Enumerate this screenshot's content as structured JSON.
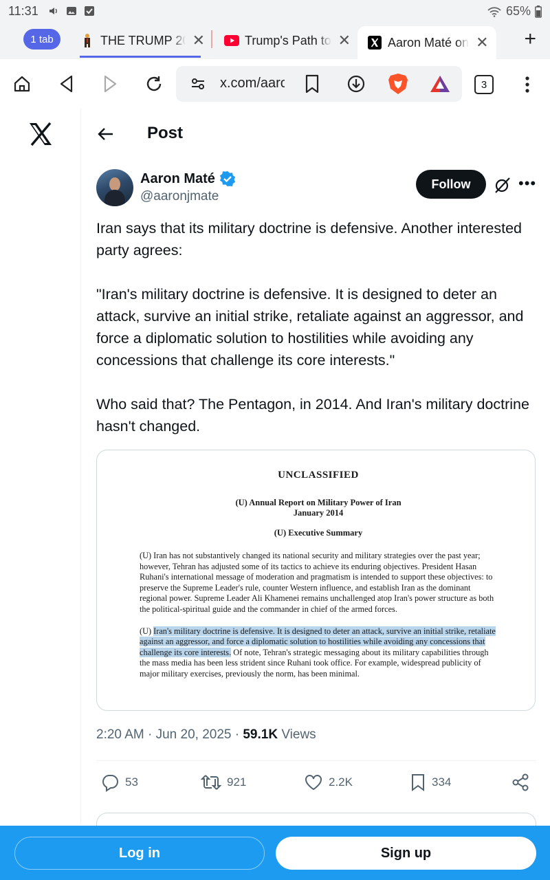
{
  "status_bar": {
    "time": "11:31",
    "battery": "65%"
  },
  "browser": {
    "tab_count_label": "1 tab",
    "tabs": [
      {
        "title": "THE TRUMP 20",
        "favicon": "trump-figure-icon"
      },
      {
        "title": "Trump's Path to",
        "favicon": "youtube-icon"
      },
      {
        "title": "Aaron Maté on",
        "favicon": "x-icon",
        "active": true
      }
    ],
    "url": "x.com/aaronjmate",
    "open_tabs": "3"
  },
  "page": {
    "header_title": "Post",
    "author": {
      "name": "Aaron Maté",
      "handle": "@aaronjmate",
      "verified": true
    },
    "follow_label": "Follow",
    "tweet": {
      "para1": "Iran says that its military doctrine is defensive. Another interested party agrees:",
      "para2": "\"Iran's military doctrine is defensive. It is designed to deter an attack, survive an initial strike, retaliate against an aggressor, and force a diplomatic solution to hostilities while avoiding any concessions that challenge its core interests.\"",
      "para3": "Who said that? The Pentagon, in 2014. And Iran's military doctrine hasn't changed."
    },
    "document": {
      "classification": "UNCLASSIFIED",
      "report_title": "(U) Annual Report on Military Power of Iran",
      "report_date": "January 2014",
      "section": "(U) Executive Summary",
      "paragraph1": "(U) Iran has not substantively changed its national security and military strategies over the past year; however, Tehran has adjusted some of its tactics to achieve its enduring objectives. President Hasan Ruhani's international message of moderation and pragmatism is intended to support these objectives: to preserve the Supreme Leader's rule, counter Western influence, and establish Iran as the dominant regional power. Supreme Leader Ali Khamenei remains unchallenged atop Iran's power structure as both the political-spiritual guide and the commander in chief of the armed forces.",
      "paragraph2_prefix": "(U)",
      "paragraph2_highlight": "Iran's military doctrine is defensive. It is designed to deter an attack, survive an initial strike, retaliate against an aggressor, and force a diplomatic solution to hostilities while avoiding any concessions that challenge its core interests.",
      "paragraph2_rest": "Of note, Tehran's strategic messaging about its military capabilities through the mass media has been less strident since Ruhani took office. For example, widespread publicity of major military exercises, previously the norm, has been minimal."
    },
    "timestamp": "2:20 AM · Jun 20, 2025",
    "separator": " · ",
    "views_count": "59.1K",
    "views_label": "Views",
    "stats": {
      "replies": "53",
      "reposts": "921",
      "likes": "2.2K",
      "bookmarks": "334"
    }
  },
  "banner": {
    "login_label": "Log in",
    "signup_label": "Sign up"
  },
  "colors": {
    "accent": "#1d9bf0",
    "tab_accent": "#5567e6",
    "highlight": "#b9d5ec"
  }
}
